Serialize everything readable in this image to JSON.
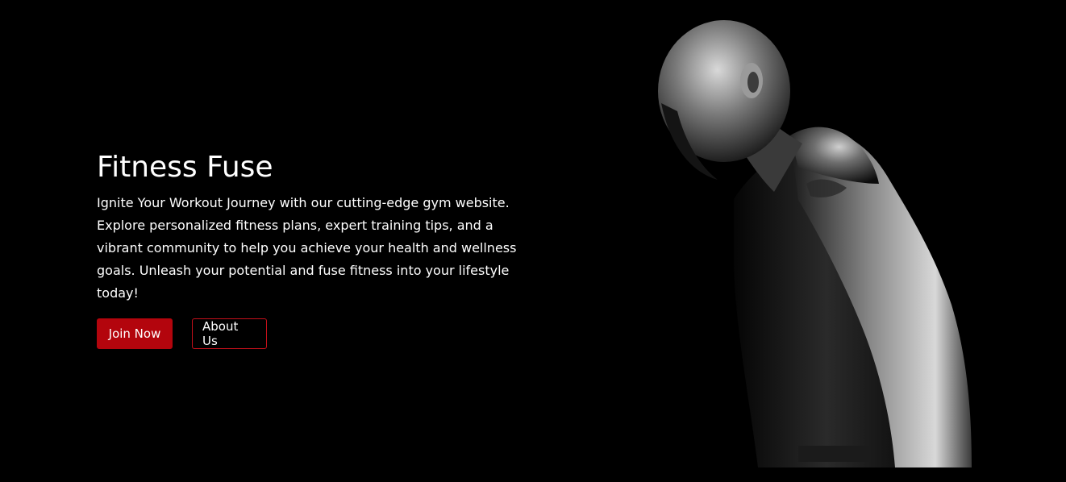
{
  "hero": {
    "title": "Fitness Fuse",
    "description": "Ignite Your Workout Journey with our cutting-edge gym website. Explore personalized fitness plans, expert training tips, and a vibrant community to help you achieve your health and wellness goals. Unleash your potential and fuse fitness into your lifestyle today!",
    "join_label": "Join Now",
    "about_label": "About Us",
    "image": "athlete-photo"
  },
  "colors": {
    "background": "#000000",
    "accent": "#b3050d",
    "text": "#ffffff"
  }
}
